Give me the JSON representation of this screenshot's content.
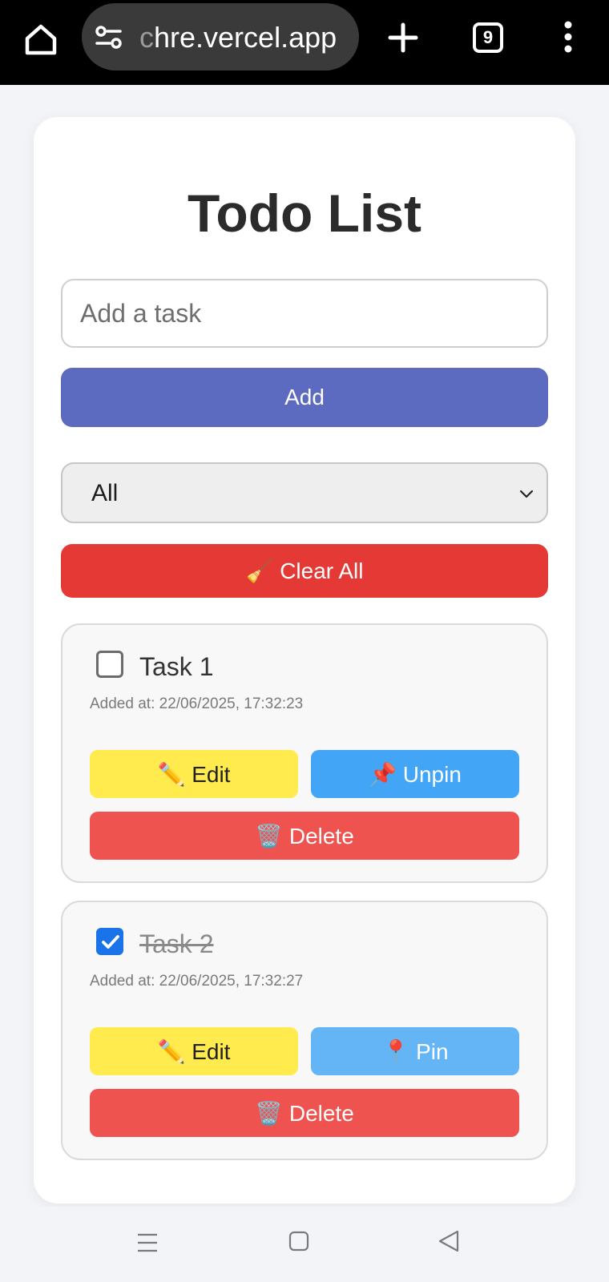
{
  "browser": {
    "url_fade": "c",
    "url_rest": "hre.vercel.app",
    "tab_count": "9",
    "icons": [
      "home-icon",
      "tune-icon",
      "plus-icon",
      "tabs-icon",
      "more-vert-icon"
    ]
  },
  "app": {
    "title": "Todo List",
    "input_placeholder": "Add a task",
    "add_label": "Add",
    "filter_value": "All",
    "clear_label": "🧹 Clear All",
    "accent_color": "#5c6bc0",
    "danger_color": "#e53935"
  },
  "todos": [
    {
      "text": "Task 1",
      "checked": false,
      "added": "Added at: 22/06/2025, 17:32:23",
      "edit_label": "✏️ Edit",
      "pin_label": "📌 Unpin",
      "delete_label": "🗑️ Delete"
    },
    {
      "text": "Task 2",
      "checked": true,
      "added": "Added at: 22/06/2025, 17:32:27",
      "edit_label": "✏️ Edit",
      "pin_label": "📍 Pin",
      "delete_label": "🗑️ Delete"
    }
  ],
  "navbar": {
    "icons": [
      "recents-icon",
      "home-square-icon",
      "back-icon"
    ]
  }
}
